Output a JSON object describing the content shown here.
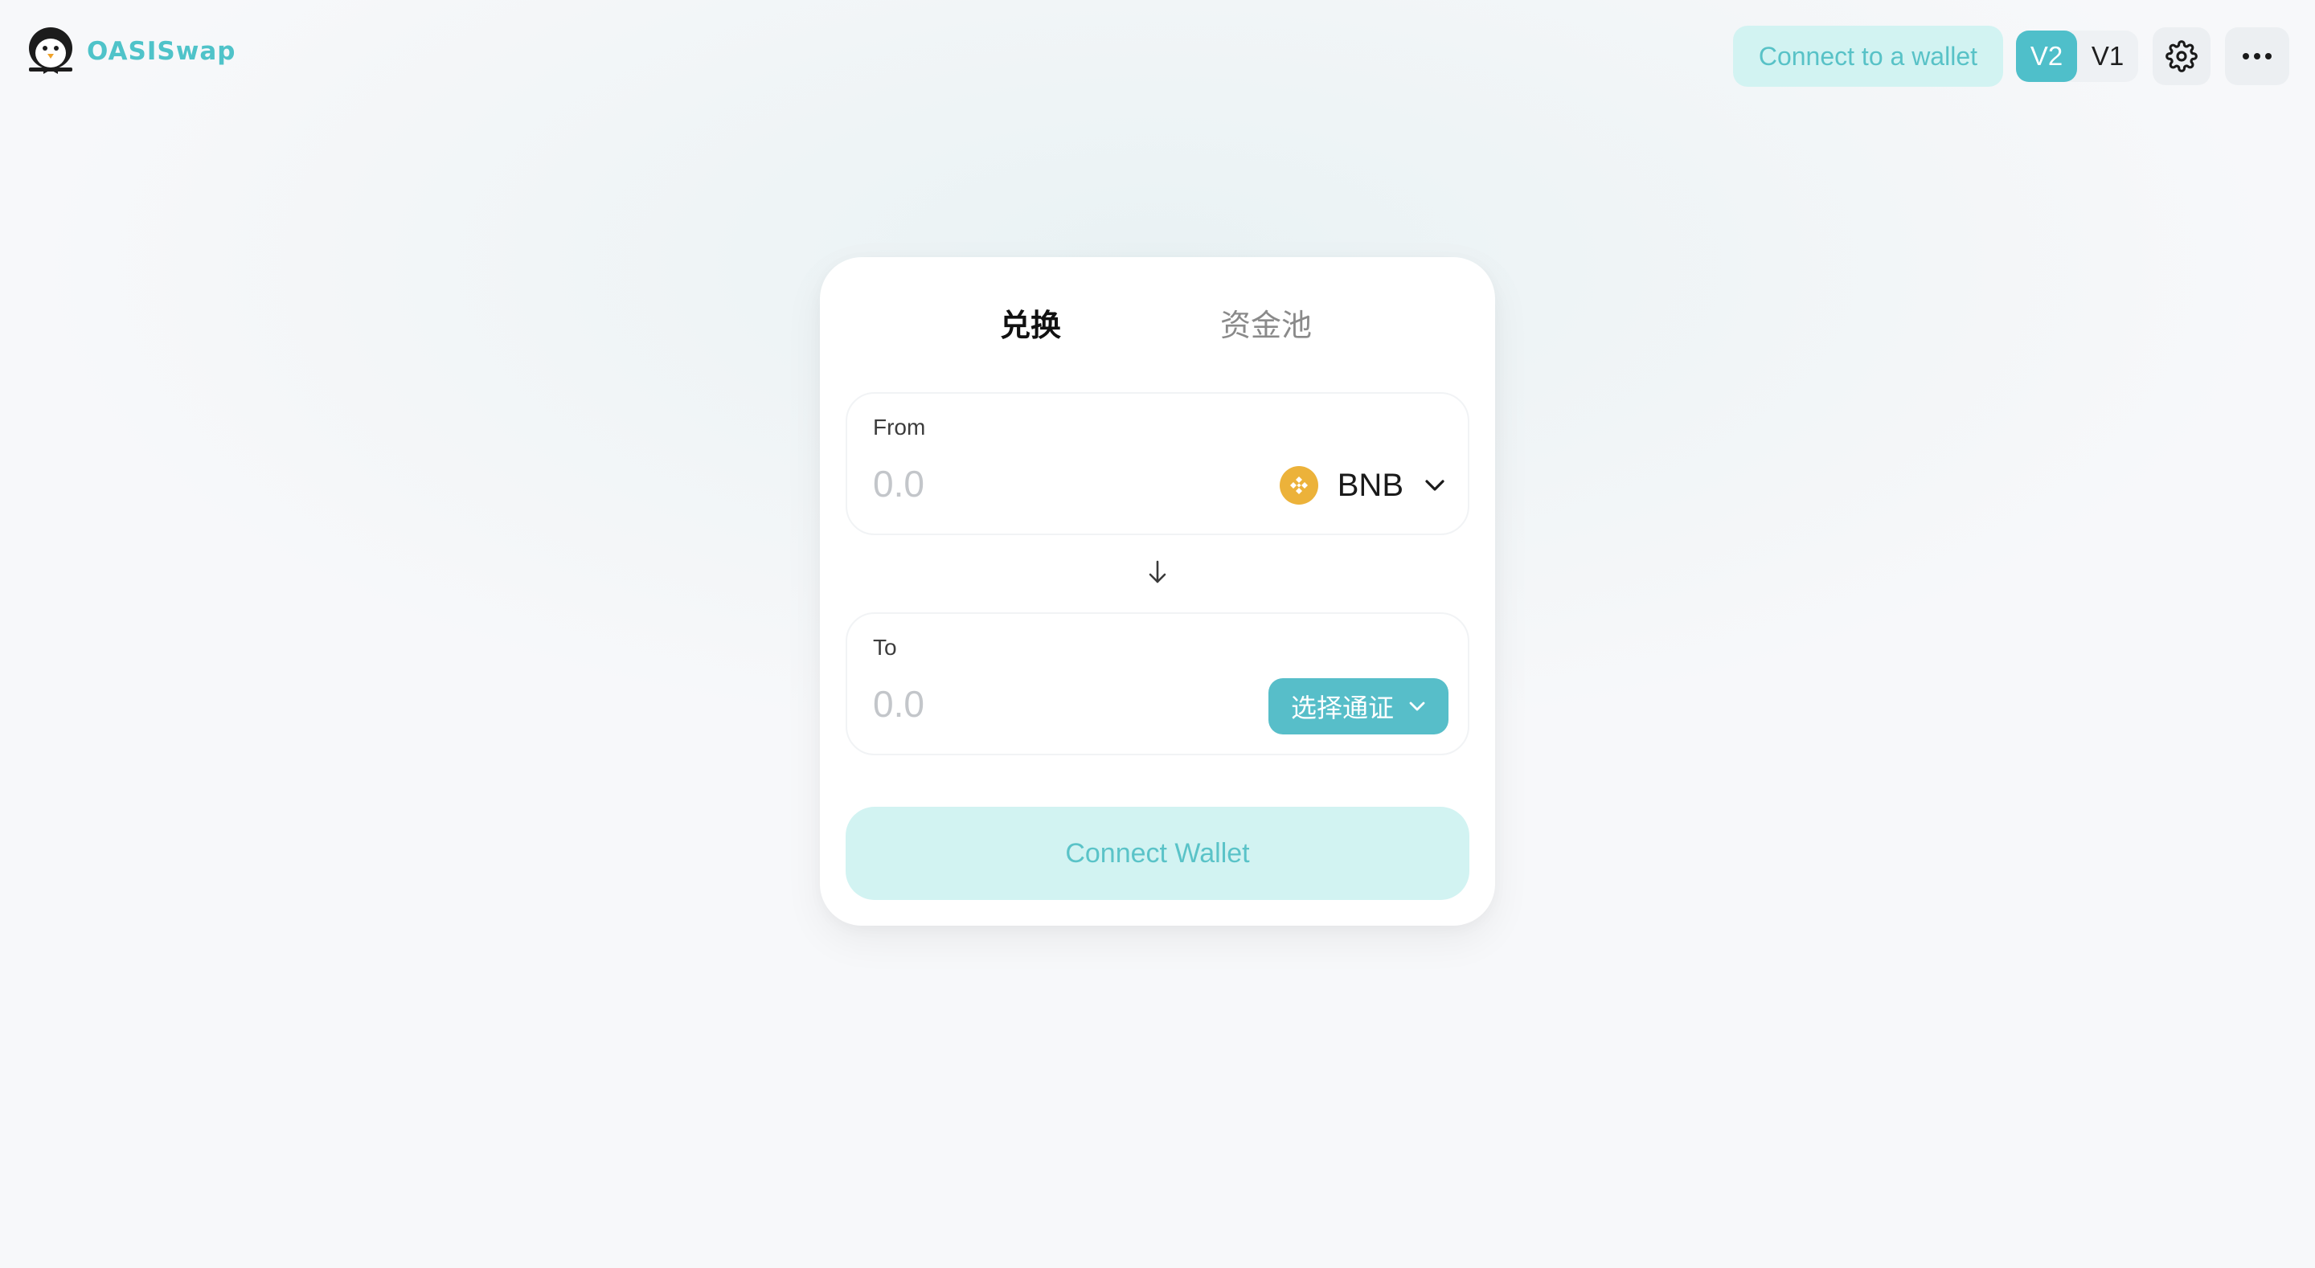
{
  "header": {
    "brand": "OASISwap",
    "connect_label": "Connect to a wallet",
    "versions": [
      {
        "label": "V2",
        "active": true
      },
      {
        "label": "V1",
        "active": false
      }
    ],
    "settings_icon": "gear-icon",
    "more_icon": "more-horizontal-icon"
  },
  "swap": {
    "tabs": [
      {
        "label": "兑换",
        "active": true
      },
      {
        "label": "资金池",
        "active": false
      }
    ],
    "from": {
      "label": "From",
      "placeholder": "0.0",
      "token": "BNB",
      "token_icon": "bnb-icon"
    },
    "to": {
      "label": "To",
      "placeholder": "0.0",
      "select_label": "选择通证"
    },
    "switch_icon": "arrow-down-icon",
    "action_label": "Connect Wallet"
  },
  "colors": {
    "accent": "#4fbfca",
    "accent_light": "#d2f3f2",
    "bnb": "#ecb23a"
  }
}
